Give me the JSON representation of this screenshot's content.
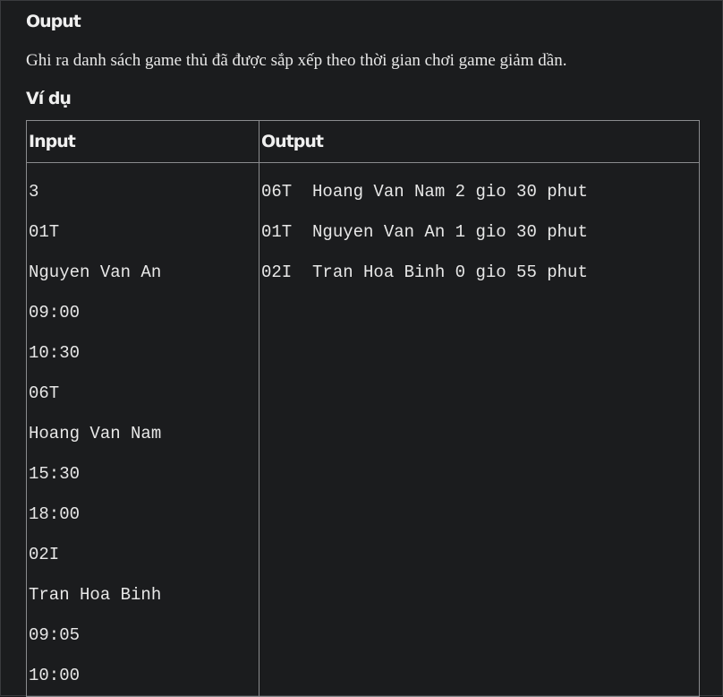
{
  "output_section": {
    "heading": "Ouput",
    "description": "Ghi ra danh sách game thủ đã được sắp xếp theo thời gian chơi game giảm dần."
  },
  "example_section": {
    "heading": "Ví dụ",
    "table": {
      "headers": [
        "Input",
        "Output"
      ],
      "input_lines": [
        "3",
        "01T",
        "Nguyen Van An",
        "09:00",
        "10:30",
        "06T",
        "Hoang Van Nam",
        "15:30",
        "18:00",
        "02I",
        "Tran Hoa Binh",
        "09:05",
        "10:00"
      ],
      "output_lines": [
        "06T  Hoang Van Nam 2 gio 30 phut",
        "01T  Nguyen Van An 1 gio 30 phut",
        "02I  Tran Hoa Binh 0 gio 55 phut"
      ]
    }
  }
}
